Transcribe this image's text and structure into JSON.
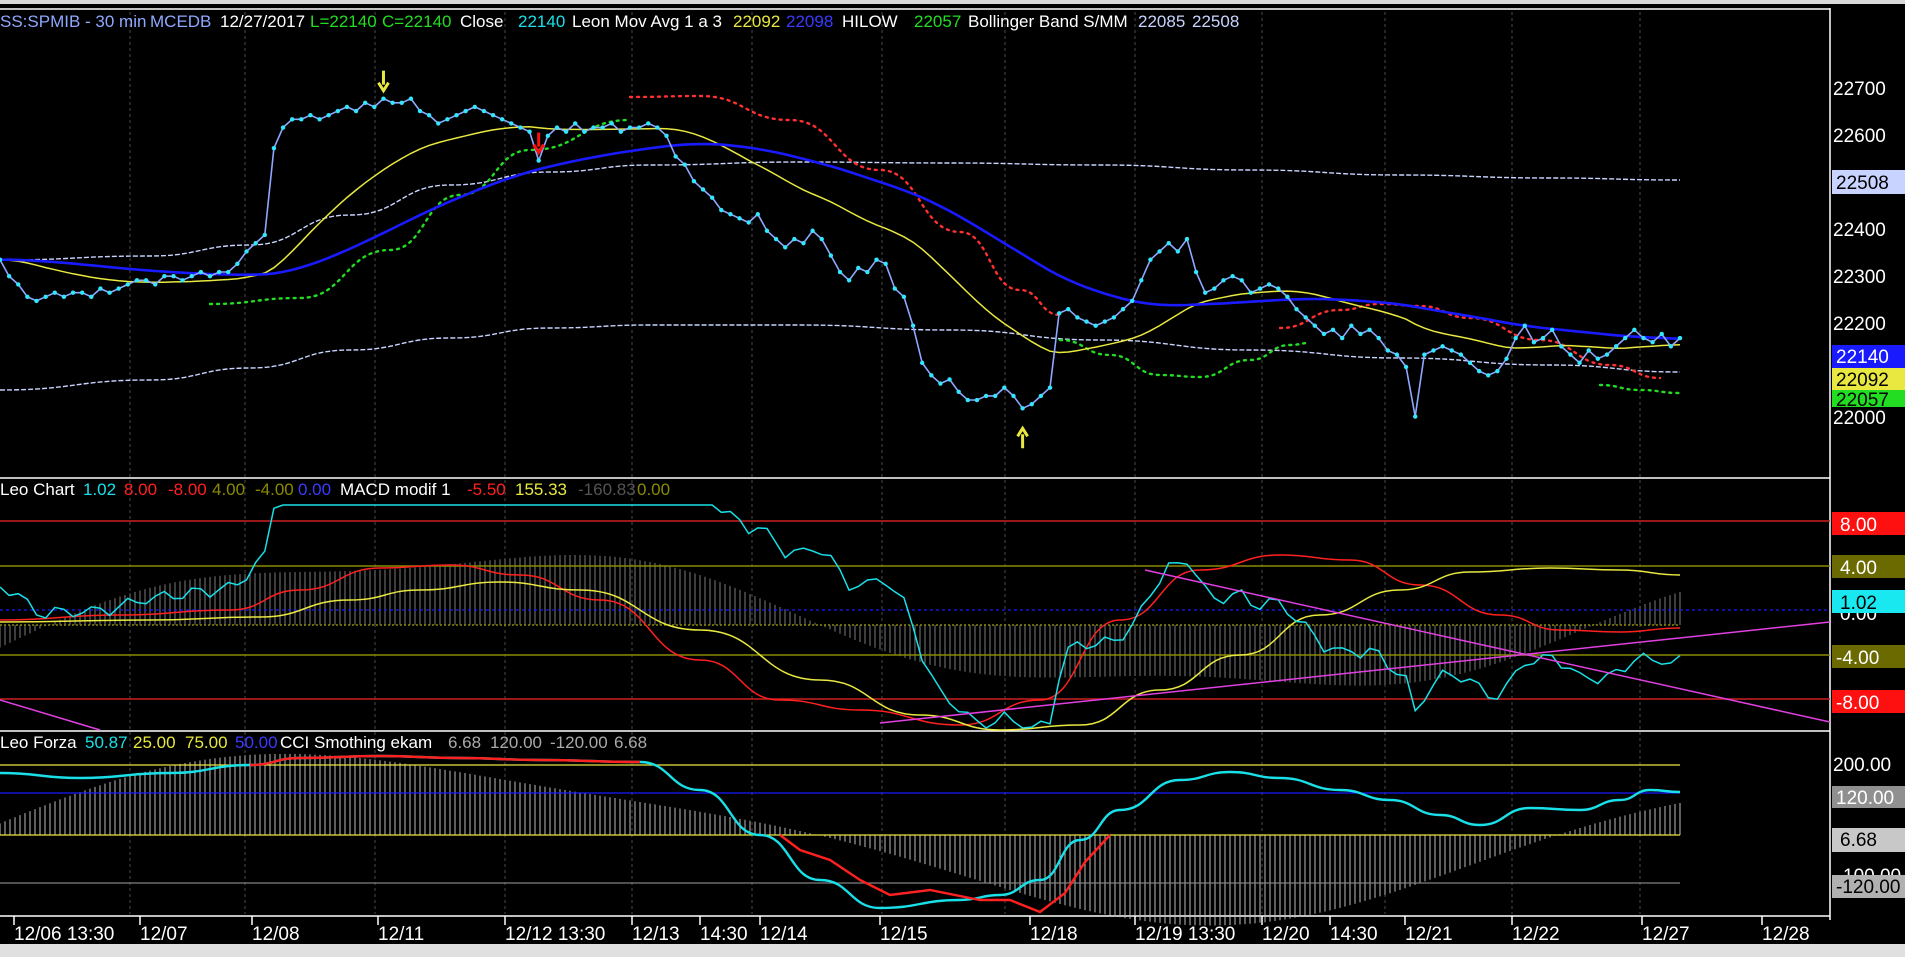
{
  "colors": {
    "background": "#000000",
    "price": "#8fa8ff",
    "price_dots": "#33e6ff",
    "mov_avg_yellow": "#e8e840",
    "mov_avg_blue": "#1a1aff",
    "hilow_red": "#ff3030",
    "hilow_green": "#22dd22",
    "bollinger": "#c8d4ff",
    "cyan": "#19e0e8",
    "red": "#ff2020",
    "yellow": "#e8e840",
    "olive": "#8a8a00",
    "gray": "#909090",
    "magenta": "#e040e0",
    "white": "#ffffff"
  },
  "top_bar": {
    "symbol": "SS:SPMIB - 30 min",
    "source": "MCEDB",
    "date": "12/27/2017",
    "low": "L=22140",
    "close_c": "C=22140",
    "close_label": "Close",
    "close_value": "22140",
    "mov_avg_label": "Leon Mov Avg 1 a 3",
    "mov_avg_v1": "22092",
    "mov_avg_v2": "22098",
    "hilow_label": "HILOW",
    "hilow_value": "22057",
    "bollinger_label": "Bollinger Band S/MM",
    "bollinger_v1": "22085",
    "bollinger_v2": "22508"
  },
  "pane2": {
    "name": "Leo Chart",
    "v1": "1.02",
    "v2": "8.00",
    "v3": "-8.00",
    "v4": "4.00",
    "v5": "-4.00",
    "v6": "0.00",
    "macd_label": "MACD modif 1",
    "macd_v1": "-5.50",
    "macd_v2": "155.33",
    "macd_v3": "-160.83",
    "macd_v4": "0.00"
  },
  "pane3": {
    "name": "Leo Forza",
    "v1": "50.87",
    "v2": "25.00",
    "v3": "75.00",
    "v4": "50.00",
    "cci_label": "CCI Smothing ekam",
    "cci_v1": "6.68",
    "cci_v2": "120.00",
    "cci_v3": "-120.00",
    "cci_v4": "6.68"
  },
  "price_axis": [
    "22700",
    "22600",
    "22500",
    "22400",
    "22300",
    "22200",
    "22100",
    "22000"
  ],
  "price_badges": {
    "bollinger_upper": "22508",
    "close": "22140",
    "mov_avg": "22092",
    "hilow": "22057"
  },
  "pane2_axis": [
    "8.00",
    "4.00",
    "1.02",
    "-4.00",
    "-8.00"
  ],
  "pane2_hidden": "0.00",
  "pane3_axis": [
    "200.00",
    "120.00",
    "6.68",
    "-120.00"
  ],
  "pane3_hidden": "100.00",
  "time_axis": [
    "12/06 13:30",
    "12/07",
    "12/08",
    "12/11",
    "12/12 13:30",
    "12/13",
    "14:30",
    "12/14",
    "12/15",
    "12/18",
    "12/19 13:30",
    "12/20",
    "14:30",
    "12/21",
    "12/22",
    "12/27",
    "12/28"
  ],
  "chart_data": {
    "type": "line",
    "price_scale": [
      21915,
      22770
    ],
    "close": [
      22330,
      22290,
      22270,
      22240,
      22230,
      22240,
      22250,
      22240,
      22250,
      22250,
      22240,
      22260,
      22250,
      22260,
      22270,
      22280,
      22280,
      22270,
      22290,
      22290,
      22280,
      22290,
      22300,
      22290,
      22300,
      22300,
      22320,
      22350,
      22370,
      22390,
      22600,
      22650,
      22670,
      22670,
      22680,
      22670,
      22680,
      22690,
      22700,
      22690,
      22710,
      22700,
      22720,
      22710,
      22710,
      22720,
      22690,
      22680,
      22660,
      22670,
      22680,
      22690,
      22700,
      22690,
      22680,
      22670,
      22660,
      22650,
      22640,
      22570,
      22630,
      22650,
      22640,
      22660,
      22640,
      22650,
      22650,
      22660,
      22640,
      22650,
      22650,
      22660,
      22650,
      22630,
      22580,
      22560,
      22520,
      22500,
      22480,
      22450,
      22440,
      22430,
      22420,
      22440,
      22400,
      22380,
      22360,
      22380,
      22370,
      22400,
      22380,
      22340,
      22300,
      22280,
      22310,
      22300,
      22330,
      22320,
      22260,
      22240,
      22170,
      22080,
      22050,
      22030,
      22040,
      22010,
      21990,
      21990,
      22000,
      22000,
      22020,
      22000,
      21970,
      21980,
      22000,
      22020,
      22200,
      22210,
      22190,
      22180,
      22170,
      22180,
      22190,
      22210,
      22230,
      22280,
      22330,
      22350,
      22370,
      22350,
      22380,
      22300,
      22250,
      22260,
      22280,
      22290,
      22280,
      22250,
      22260,
      22270,
      22260,
      22240,
      22210,
      22190,
      22170,
      22150,
      22160,
      22140,
      22170,
      22150,
      22160,
      22140,
      22110,
      22100,
      22070,
      21950,
      22100,
      22110,
      22120,
      22110,
      22100,
      22080,
      22060,
      22050,
      22060,
      22090,
      22140,
      22170,
      22130,
      22140,
      22160,
      22120,
      22100,
      22080,
      22110,
      22090,
      22100,
      22120,
      22140,
      22160,
      22140,
      22130,
      22150,
      22120,
      22140
    ],
    "signals": [
      {
        "type": "sell",
        "index": 42
      },
      {
        "type": "sell",
        "index": 59
      },
      {
        "type": "buy",
        "index": 112
      }
    ]
  }
}
